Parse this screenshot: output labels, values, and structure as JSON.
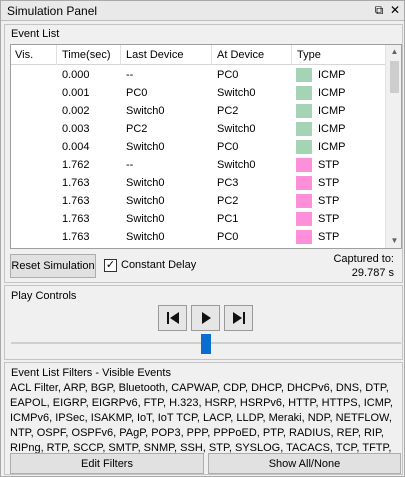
{
  "window": {
    "title": "Simulation Panel"
  },
  "event_list": {
    "label": "Event List",
    "columns": [
      "Vis.",
      "Time(sec)",
      "Last Device",
      "At Device",
      "Type"
    ],
    "rows": [
      {
        "time": "0.000",
        "last": "--",
        "at": "PC0",
        "type": "ICMP",
        "color": "#a4d4b4"
      },
      {
        "time": "0.001",
        "last": "PC0",
        "at": "Switch0",
        "type": "ICMP",
        "color": "#a4d4b4"
      },
      {
        "time": "0.002",
        "last": "Switch0",
        "at": "PC2",
        "type": "ICMP",
        "color": "#a4d4b4"
      },
      {
        "time": "0.003",
        "last": "PC2",
        "at": "Switch0",
        "type": "ICMP",
        "color": "#a4d4b4"
      },
      {
        "time": "0.004",
        "last": "Switch0",
        "at": "PC0",
        "type": "ICMP",
        "color": "#a4d4b4"
      },
      {
        "time": "1.762",
        "last": "--",
        "at": "Switch0",
        "type": "STP",
        "color": "#ff8fd8"
      },
      {
        "time": "1.763",
        "last": "Switch0",
        "at": "PC3",
        "type": "STP",
        "color": "#ff8fd8"
      },
      {
        "time": "1.763",
        "last": "Switch0",
        "at": "PC2",
        "type": "STP",
        "color": "#ff8fd8"
      },
      {
        "time": "1.763",
        "last": "Switch0",
        "at": "PC1",
        "type": "STP",
        "color": "#ff8fd8"
      },
      {
        "time": "1.763",
        "last": "Switch0",
        "at": "PC0",
        "type": "STP",
        "color": "#ff8fd8"
      }
    ],
    "reset_label": "Reset Simulation",
    "constant_delay_label": "Constant Delay",
    "constant_delay_checked": true,
    "captured_label": "Captured to:",
    "captured_value": "29.787 s"
  },
  "play_controls": {
    "label": "Play Controls",
    "progress": 0.5
  },
  "filters": {
    "label": "Event List Filters - Visible Events",
    "text": "ACL Filter, ARP, BGP, Bluetooth, CAPWAP, CDP, DHCP, DHCPv6, DNS, DTP, EAPOL, EIGRP, EIGRPv6, FTP, H.323, HSRP, HSRPv6, HTTP, HTTPS, ICMP, ICMPv6, IPSec, ISAKMP, IoT, IoT TCP, LACP, LLDP, Meraki, NDP, NETFLOW, NTP, OSPF, OSPFv6, PAgP, POP3, PPP, PPPoED, PTP, RADIUS, REP, RIP, RIPng, RTP, SCCP, SMTP, SNMP, SSH, STP, SYSLOG, TACACS, TCP, TFTP, Telnet, UDP, USB, VTP",
    "edit_label": "Edit Filters",
    "show_all_label": "Show All/None"
  }
}
